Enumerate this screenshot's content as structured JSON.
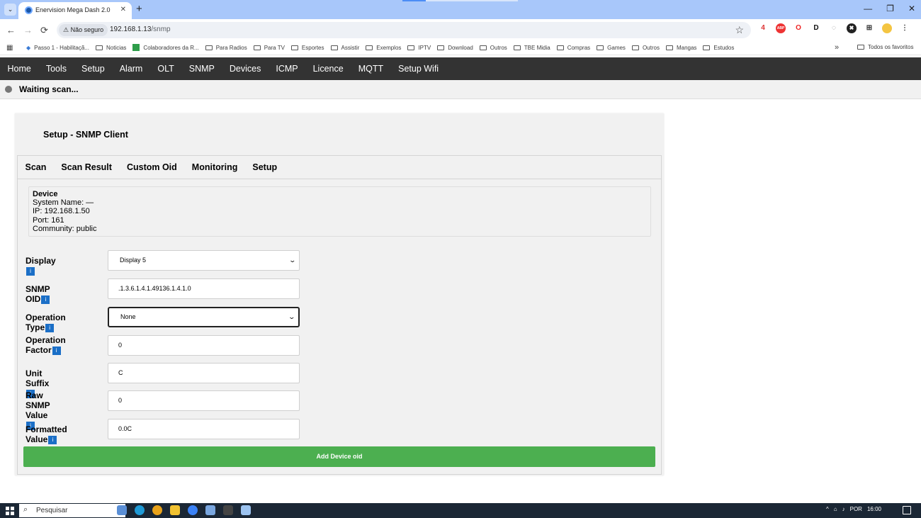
{
  "browser": {
    "tab_title": "Enervision Mega Dash 2.0",
    "tab_close": "✕",
    "new_tab": "+",
    "security_chip": "Não seguro",
    "url_host": "192.168.1.13",
    "url_path": "/snmp",
    "window_controls": [
      "—",
      "❐",
      "✕"
    ],
    "extensions": [
      "4",
      "ABP",
      "O",
      "D",
      "◌",
      "✖",
      "⊞"
    ],
    "bookmarks": [
      "Passo 1 - Habilitaçã...",
      "Noticias",
      "Colaboradores da R...",
      "Para Radios",
      "Para TV",
      "Esportes",
      "Assistir",
      "Exemplos",
      "IPTV",
      "Download",
      "Outros",
      "TBE Midia",
      "Compras",
      "Games",
      "Outros",
      "Mangas",
      "Estudos"
    ],
    "bookmarks_more": "»",
    "all_bookmarks": "Todos os favoritos"
  },
  "app": {
    "nav": [
      "Home",
      "Tools",
      "Setup",
      "Alarm",
      "OLT",
      "SNMP",
      "Devices",
      "ICMP",
      "Licence",
      "MQTT",
      "Setup Wifi"
    ],
    "status": "Waiting scan...",
    "panel_title": "Setup - SNMP Client",
    "subtabs": [
      "Scan",
      "Scan Result",
      "Custom Oid",
      "Monitoring",
      "Setup"
    ],
    "device": {
      "heading": "Device",
      "system_name": "System Name: —",
      "ip": "IP: 192.168.1.50",
      "port": "Port: 161",
      "community": "Community: public"
    },
    "form": {
      "display_label": "Display",
      "display_value": "Display 5",
      "oid_label": "SNMP OID",
      "oid_value": ".1.3.6.1.4.1.49136.1.4.1.0",
      "optype_label": "Operation Type",
      "optype_value": "None",
      "factor_label_1": "Operation",
      "factor_label_2": "Factor",
      "factor_value": "0",
      "unit_label": "Unit Suffix",
      "unit_value": "C",
      "raw_label_1": "Raw SNMP",
      "raw_label_2": "Value",
      "raw_value": "0",
      "formatted_label": "Formatted Value",
      "formatted_value": "0.0C",
      "info_glyph": "i",
      "add_button": "Add Device oid"
    }
  },
  "taskbar": {
    "search_placeholder": "Pesquisar",
    "tray": [
      "^",
      "POR",
      "16:00"
    ]
  }
}
